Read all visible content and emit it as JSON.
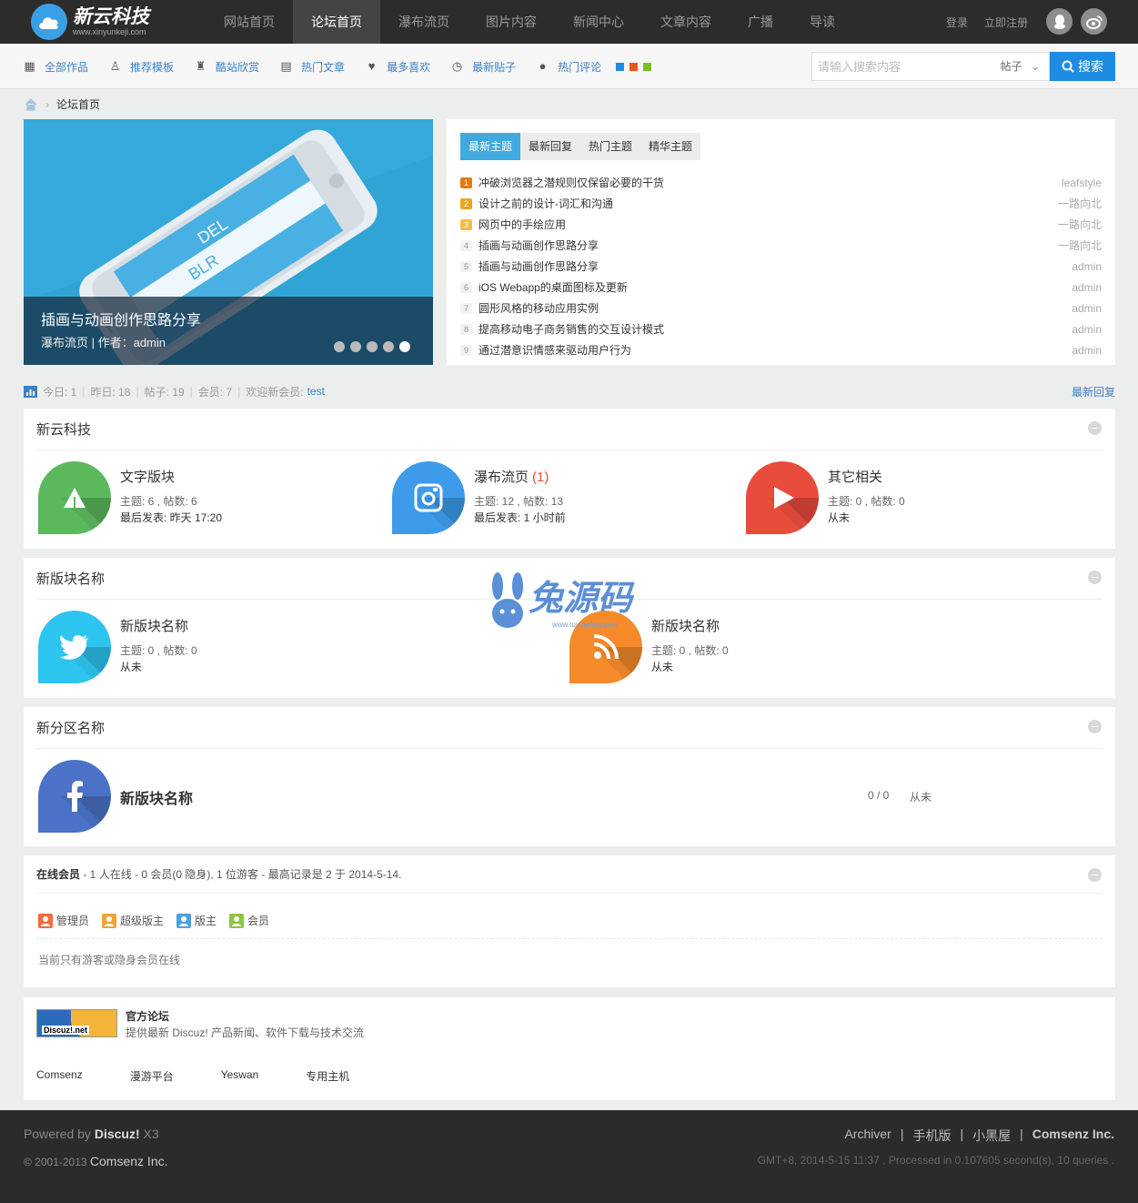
{
  "header": {
    "logo_title": "新云科技",
    "logo_sub": "www.xinyunkeji.com",
    "nav": [
      {
        "label": "网站首页"
      },
      {
        "label": "论坛首页",
        "active": true
      },
      {
        "label": "瀑布流页"
      },
      {
        "label": "图片内容"
      },
      {
        "label": "新闻中心"
      },
      {
        "label": "文章内容"
      },
      {
        "label": "广播"
      },
      {
        "label": "导读"
      }
    ],
    "login": "登录",
    "register": "立即注册"
  },
  "subnav": {
    "items": [
      {
        "label": "全部作品",
        "icon": "grid-icon"
      },
      {
        "label": "推荐模板",
        "icon": "ribbon-icon"
      },
      {
        "label": "酷站欣赏",
        "icon": "trophy-icon"
      },
      {
        "label": "热门文章",
        "icon": "document-icon"
      },
      {
        "label": "最多喜欢",
        "icon": "heart-icon"
      },
      {
        "label": "最新贴子",
        "icon": "clock-icon"
      },
      {
        "label": "热门评论",
        "icon": "comment-icon"
      }
    ],
    "swatches": [
      "#1e8ce0",
      "#e8581a",
      "#7cc21e"
    ]
  },
  "search": {
    "placeholder": "请输入搜索内容",
    "type": "帖子",
    "button": "搜索"
  },
  "breadcrumb": {
    "current": "论坛首页"
  },
  "slider": {
    "title": "插画与动画创作思路分享",
    "meta": "瀑布流页 | 作者：admin",
    "phone_city": "BLR",
    "phone_dest": "DEL",
    "active_dot": 5
  },
  "thread_tabs": [
    "最新主题",
    "最新回复",
    "热门主题",
    "精华主题"
  ],
  "threads": [
    {
      "n": "1",
      "title": "冲破浏览器之潜规则仅保留必要的干货",
      "author": "leafstyle"
    },
    {
      "n": "2",
      "title": "设计之前的设计-词汇和沟通",
      "author": "一路向北"
    },
    {
      "n": "3",
      "title": "网页中的手绘应用",
      "author": "一路向北"
    },
    {
      "n": "4",
      "title": "插画与动画创作思路分享",
      "author": "一路向北"
    },
    {
      "n": "5",
      "title": "插画与动画创作思路分享",
      "author": "admin"
    },
    {
      "n": "6",
      "title": "iOS Webapp的桌面图标及更新",
      "author": "admin"
    },
    {
      "n": "7",
      "title": "圆形风格的移动应用实例",
      "author": "admin"
    },
    {
      "n": "8",
      "title": "提高移动电子商务销售的交互设计模式",
      "author": "admin"
    },
    {
      "n": "9",
      "title": "通过潜意识情感来驱动用户行为",
      "author": "admin"
    }
  ],
  "stats": {
    "today": "今日: 1",
    "yesterday": "昨日: 18",
    "posts": "帖子: 19",
    "members": "会员: 7",
    "welcome": "欢迎新会员:",
    "newest": "test",
    "latest_reply": "最新回复"
  },
  "sections": [
    {
      "title": "新云科技",
      "forums": [
        {
          "name": "文字版块",
          "new_count": "",
          "meta": "主题: 6 , 帖数: 6",
          "last": "最后发表: 昨天 17:20",
          "color": "#5cb85c",
          "icon": "tree-icon"
        },
        {
          "name": "瀑布流页",
          "new_count": "(1)",
          "meta": "主题: 12 , 帖数: 13",
          "last": "最后发表: 1 小时前",
          "color": "#3d9be9",
          "icon": "camera-icon"
        },
        {
          "name": "其它相关",
          "new_count": "",
          "meta": "主题: 0 , 帖数: 0",
          "last": "从未",
          "color": "#e84c3d",
          "icon": "play-icon"
        }
      ]
    },
    {
      "title": "新版块名称",
      "forums": [
        {
          "name": "新版块名称",
          "meta": "主题: 0 , 帖数: 0",
          "last": "从未",
          "color": "#2ec4f0",
          "icon": "twitter-icon"
        },
        {
          "name": "新版块名称",
          "meta": "主题: 0 , 帖数: 0",
          "last": "从未",
          "color": "#f58a2b",
          "icon": "rss-icon"
        }
      ]
    },
    {
      "title": "新分区名称",
      "forums": [
        {
          "name": "新版块名称",
          "counts": "0 / 0",
          "last": "从未",
          "color": "#4b72c7",
          "icon": "facebook-icon"
        }
      ]
    }
  ],
  "online": {
    "label": "在线会员",
    "summary": " - 1 人在线 - 0 会员(0 隐身), 1 位游客 - 最高记录是 2 于 2014-5-14.",
    "legend": [
      {
        "label": "管理员",
        "color": "#f26b3a"
      },
      {
        "label": "超级版主",
        "color": "#f2a23a"
      },
      {
        "label": "版主",
        "color": "#4aa3df"
      },
      {
        "label": "会员",
        "color": "#8cc63f"
      }
    ],
    "note": "当前只有游客或隐身会员在线"
  },
  "links": {
    "official_title": "官方论坛",
    "official_desc": "提供最新 Discuz! 产品新闻、软件下载与技术交流",
    "badge": "Discuz!.net",
    "friends": [
      "Comsenz",
      "漫游平台",
      "Yeswan",
      "专用主机"
    ]
  },
  "watermark": {
    "text": "兔源码",
    "url": "www.tuyuanma.com"
  },
  "footer": {
    "powered": "Powered by",
    "product": "Discuz!",
    "version": "X3",
    "copyright": "© 2001-2013",
    "company": "Comsenz Inc.",
    "links": [
      "Archiver",
      "手机版",
      "小黑屋",
      "Comsenz Inc."
    ],
    "debug": "GMT+8, 2014-5-15 11:37 , Processed in 0.107605 second(s), 10 queries ."
  }
}
